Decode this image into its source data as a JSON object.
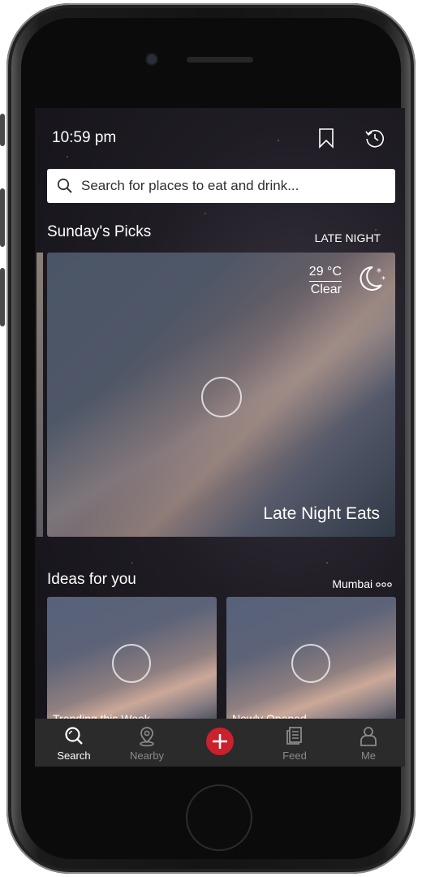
{
  "status_bar": {
    "time": "10:59 pm"
  },
  "search": {
    "placeholder": "Search for places to eat and drink..."
  },
  "picks": {
    "title": "Sunday's Picks",
    "period": "LATE NIGHT",
    "weather": {
      "temperature": "29 °C",
      "condition": "Clear",
      "icon": "moon-stars-icon"
    },
    "hero_caption": "Late Night Eats"
  },
  "ideas": {
    "title": "Ideas for you",
    "location": "Mumbai",
    "location_suffix_icon": "three-dots-icon",
    "cards": [
      {
        "label": "Trending this Week"
      },
      {
        "label": "Newly Opened"
      }
    ]
  },
  "tabbar": {
    "tabs": [
      {
        "label": "Search",
        "icon": "search-icon",
        "active": true
      },
      {
        "label": "Nearby",
        "icon": "location-pin-icon",
        "active": false
      },
      {
        "label": "Feed",
        "icon": "feed-icon",
        "active": false
      },
      {
        "label": "Me",
        "icon": "user-icon",
        "active": false
      }
    ],
    "center_button_icon": "plus-icon"
  },
  "colors": {
    "accent": "#cb202d",
    "tabbar_bg": "#2b2b2b",
    "inactive": "#8a8a8a"
  }
}
